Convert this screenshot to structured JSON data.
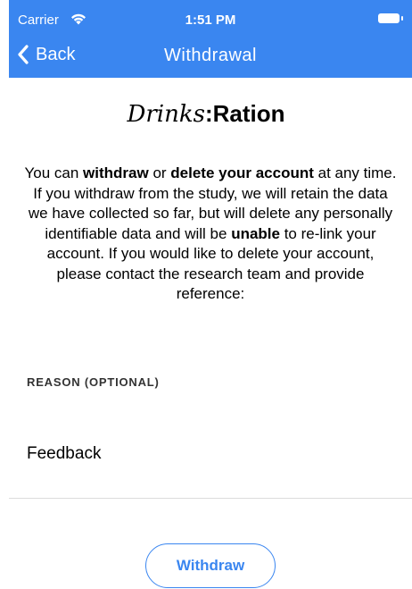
{
  "status_bar": {
    "carrier": "Carrier",
    "time": "1:51 PM"
  },
  "nav": {
    "back_label": "Back",
    "title": "Withdrawal"
  },
  "logo": {
    "script_part": "Drinks",
    "separator": ":",
    "bold_part": "Ration"
  },
  "body_text": {
    "p1": "You can ",
    "b1": "withdraw",
    "p2": " or ",
    "b2": "delete your account",
    "p3": " at any time. If you withdraw from the study, we will retain the data we have collected so far, but will delete any personally identifiable data and will be ",
    "b3": "unable",
    "p4": " to re-link your account. If you would like to delete your account, please contact the research team and provide reference:"
  },
  "reason": {
    "section_label": "REASON (OPTIONAL)",
    "feedback_label": "Feedback"
  },
  "actions": {
    "withdraw_label": "Withdraw"
  },
  "colors": {
    "accent": "#3a86f0",
    "header_bg": "#3a86f0"
  },
  "icons": {
    "back": "chevron-left-icon",
    "wifi": "wifi-icon",
    "battery": "battery-icon"
  }
}
